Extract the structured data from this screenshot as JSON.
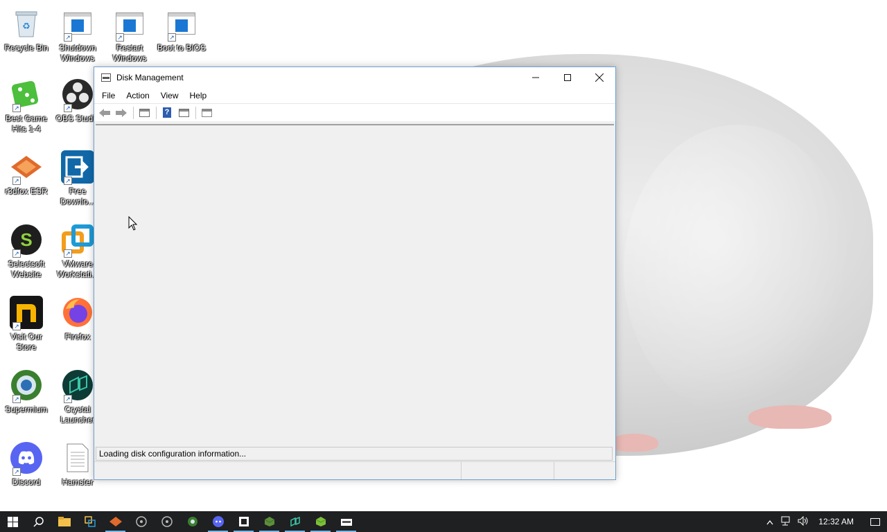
{
  "desktop": {
    "icons": [
      {
        "label": "Recycle Bin",
        "icon": "recycle-bin-icon"
      },
      {
        "label": "Shutdown Windows",
        "icon": "window-tile-icon"
      },
      {
        "label": "Restart Windows",
        "icon": "window-tile-icon"
      },
      {
        "label": "Boot to BIOS",
        "icon": "window-tile-icon"
      },
      {
        "label": "Best Game Hits 1-4",
        "icon": "dice-icon"
      },
      {
        "label": "OBS Studio",
        "icon": "obs-icon"
      },
      {
        "label": "r3dfox ESR",
        "icon": "r3dfox-icon"
      },
      {
        "label": "Free Downlo...",
        "icon": "download-arrow-icon"
      },
      {
        "label": "Selectsoft Website",
        "icon": "selectsoft-icon"
      },
      {
        "label": "VMware Workstati...",
        "icon": "vmware-icon"
      },
      {
        "label": "Visit Our Store",
        "icon": "store-icon"
      },
      {
        "label": "Firefox",
        "icon": "firefox-icon"
      },
      {
        "label": "Supermium",
        "icon": "supermium-icon"
      },
      {
        "label": "Crystal Launcher",
        "icon": "crystal-launcher-icon"
      },
      {
        "label": "Discord",
        "icon": "discord-icon"
      },
      {
        "label": "Hamster",
        "icon": "text-file-icon"
      }
    ]
  },
  "window": {
    "title": "Disk Management",
    "menu": [
      "File",
      "Action",
      "View",
      "Help"
    ],
    "status_message": "Loading disk configuration information...",
    "toolbar_icons": [
      "back-arrow-icon",
      "forward-arrow-icon",
      "console-tree-icon",
      "help-icon",
      "properties-icon",
      "view-icon"
    ]
  },
  "taskbar": {
    "apps": [
      "search-icon",
      "file-explorer-icon",
      "task-view-icon",
      "r3dfox-icon",
      "obs-icon",
      "obs-icon",
      "supermium-icon",
      "discord-icon",
      "vmware-icon",
      "minecraft-icon",
      "crystal-launcher-icon",
      "minecraft-icon",
      "disk-management-icon"
    ],
    "clock": "12:32 AM"
  },
  "colors": {
    "accent": "#1a78d4",
    "taskbar": "#1f2021",
    "window_border": "#6ea0d0"
  }
}
